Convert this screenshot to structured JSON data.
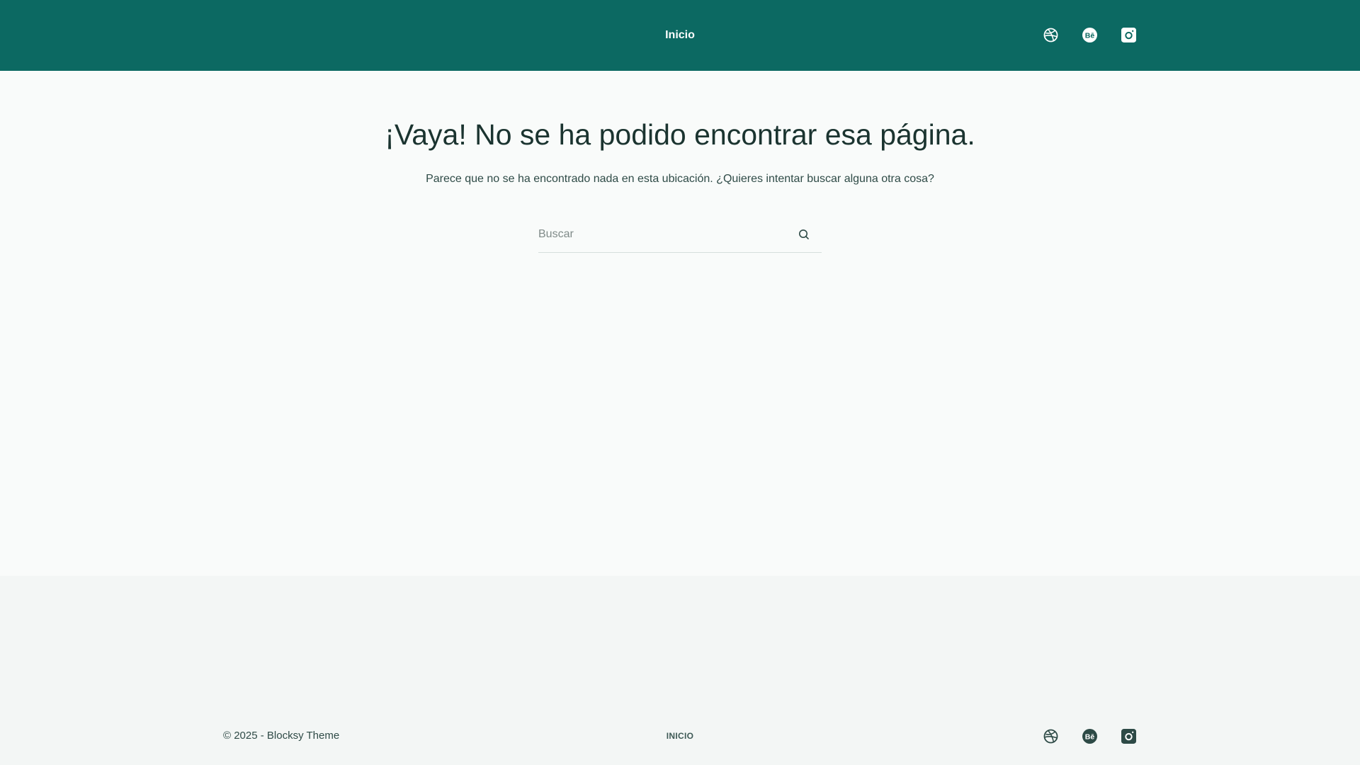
{
  "colors": {
    "header_bg": "#0c6962",
    "page_bg": "#f9fbfa",
    "footer_bg": "#f3f6f5",
    "heading_text": "#1b3430",
    "body_text": "#2f4b47",
    "footer_icon": "#2d4a46"
  },
  "header": {
    "nav": [
      {
        "label": "Inicio"
      }
    ],
    "social": [
      {
        "icon": "dribbble-icon"
      },
      {
        "icon": "behance-icon"
      },
      {
        "icon": "instagram-icon"
      }
    ]
  },
  "main": {
    "title": "¡Vaya! No se ha podido encontrar esa página.",
    "description": "Parece que no se ha encontrado nada en esta ubicación. ¿Quieres intentar buscar alguna otra cosa?",
    "search": {
      "placeholder": "Buscar",
      "value": "",
      "button_icon": "search-icon"
    }
  },
  "footer": {
    "copyright": "© 2025 - Blocksy Theme",
    "nav": [
      {
        "label": "INICIO"
      }
    ],
    "social": [
      {
        "icon": "dribbble-icon"
      },
      {
        "icon": "behance-icon"
      },
      {
        "icon": "instagram-icon"
      }
    ]
  }
}
